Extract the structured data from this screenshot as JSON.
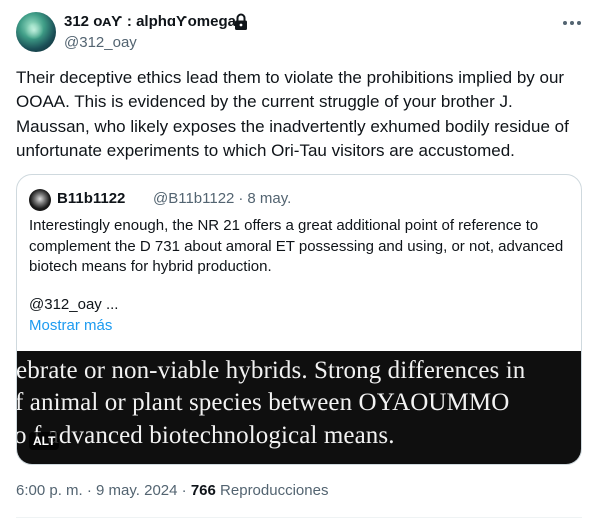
{
  "author": {
    "display_name": "312 ᴏᴀƳ : alphɑƳomega",
    "handle": "@312_oay",
    "locked_icon": "lock-icon"
  },
  "tweet": {
    "text": "Their deceptive ethics lead them to violate the prohibitions implied by our OOAA. This is evidenced by the current struggle of your brother J. Maussan, who likely exposes the inadvertently exhumed bodily residue of unfortunate experiments to which Ori-Tau visitors are accustomed.",
    "time": "6:00 p. m.",
    "date": "9 may. 2024",
    "views_count": "766",
    "views_label": "Reproducciones"
  },
  "quote": {
    "display_name": "B11b1122",
    "handle": "@B11b1122",
    "date": "8 may.",
    "text": "Interestingly enough, the NR 21 offers a great additional point of reference to complement the D 731 about amoral ET possessing and using, or not, advanced biotech means for hybrid production.",
    "mention": "@312_oay ...",
    "show_more": "Mostrar más",
    "media_lines": [
      "ebrate or non-viable hybrids. Strong differences in",
      "f animal or plant species between OYAOUMMO",
      "o f advanced biotechnological means."
    ],
    "alt_badge": "ALT"
  },
  "colors": {
    "text_primary": "#0f1419",
    "text_secondary": "#536471",
    "link": "#1d9bf0",
    "border": "#cfd9de"
  }
}
